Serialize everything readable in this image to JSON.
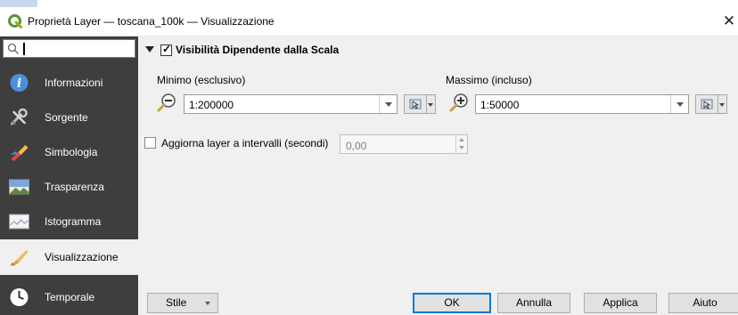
{
  "window": {
    "title": "Proprietà Layer — toscana_100k — Visualizzazione",
    "close_glyph": "✕",
    "app_icon": "qgis-logo-icon"
  },
  "sidebar": {
    "search": {
      "value": ""
    },
    "items": [
      {
        "label": "Informazioni",
        "icon": "info-icon"
      },
      {
        "label": "Sorgente",
        "icon": "source-tools-icon"
      },
      {
        "label": "Simbologia",
        "icon": "symbology-brush-icon"
      },
      {
        "label": "Trasparenza",
        "icon": "transparency-icon"
      },
      {
        "label": "Istogramma",
        "icon": "histogram-icon"
      },
      {
        "label": "Visualizzazione",
        "icon": "rendering-brush-icon",
        "selected": true
      },
      {
        "label": "Temporale",
        "icon": "clock-icon"
      }
    ]
  },
  "scale_visibility": {
    "enabled": true,
    "collapsed": false,
    "title": "Visibilità Dipendente dalla Scala",
    "minimum": {
      "label": "Minimo (esclusivo)",
      "value": "1:200000",
      "icon": "zoom-out-icon"
    },
    "maximum": {
      "label": "Massimo (incluso)",
      "value": "1:50000",
      "icon": "zoom-in-icon"
    }
  },
  "refresh": {
    "checked": false,
    "label": "Aggiorna layer a intervalli (secondi)",
    "value": "0,00",
    "enabled": false
  },
  "buttons": {
    "style": "Stile",
    "ok": "OK",
    "cancel": "Annulla",
    "apply": "Applica",
    "help": "Aiuto"
  }
}
